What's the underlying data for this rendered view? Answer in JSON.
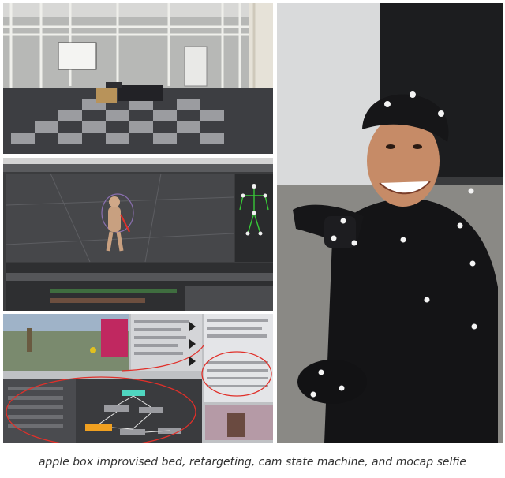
{
  "caption": "apple box improvised bed, retargeting, cam state machine, and mocap selfie",
  "panels": {
    "studio": {
      "description_icon": "studio-room"
    },
    "retarget": {
      "icon": "software-window"
    },
    "statemachine": {
      "icon": "state-machine-graph"
    },
    "selfie": {
      "icon": "photo"
    }
  },
  "colors": {
    "accent_red": "#e0302a",
    "node_orange": "#f0a020",
    "node_teal": "#4fd6c0",
    "skeleton_green": "#37c837"
  }
}
